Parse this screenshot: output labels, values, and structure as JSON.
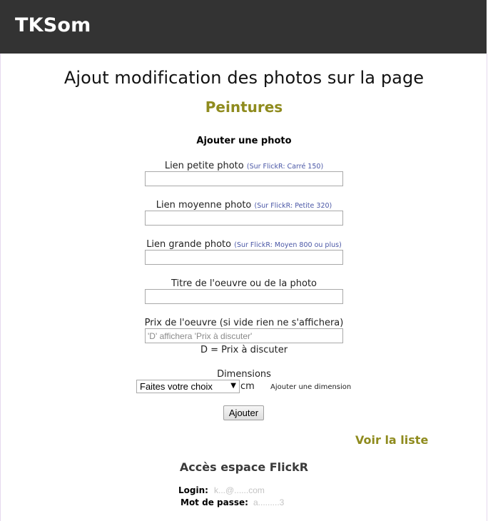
{
  "header": {
    "brand": "TKSom"
  },
  "page": {
    "title": "Ajout modification des photos sur la page",
    "section": "Peintures"
  },
  "form": {
    "heading": "Ajouter une photo",
    "small_photo": {
      "label": "Lien petite photo",
      "hint": "(Sur FlickR: Carré 150)",
      "value": ""
    },
    "medium_photo": {
      "label": "Lien moyenne photo",
      "hint": "(Sur FlickR: Petite 320)",
      "value": ""
    },
    "large_photo": {
      "label": "Lien grande photo",
      "hint": "(Sur FlickR: Moyen 800 ou plus)",
      "value": ""
    },
    "title_field": {
      "label": "Titre de l'oeuvre ou de la photo",
      "value": ""
    },
    "price": {
      "label": "Prix de l'oeuvre (si vide rien ne s'affichera)",
      "placeholder": "'D' affichera 'Prix à discuter'",
      "note": "D = Prix à discuter"
    },
    "dimensions": {
      "label": "Dimensions",
      "selected": "Faites votre choix",
      "unit": "cm",
      "add_link": "Ajouter une dimension"
    },
    "submit": "Ajouter"
  },
  "links": {
    "view_list": "Voir la liste"
  },
  "flickr": {
    "title": "Accès espace FlickR",
    "login_label": "Login:",
    "login_value": "k...@......com",
    "password_label": "Mot de passe:",
    "password_value": "a.........3"
  }
}
